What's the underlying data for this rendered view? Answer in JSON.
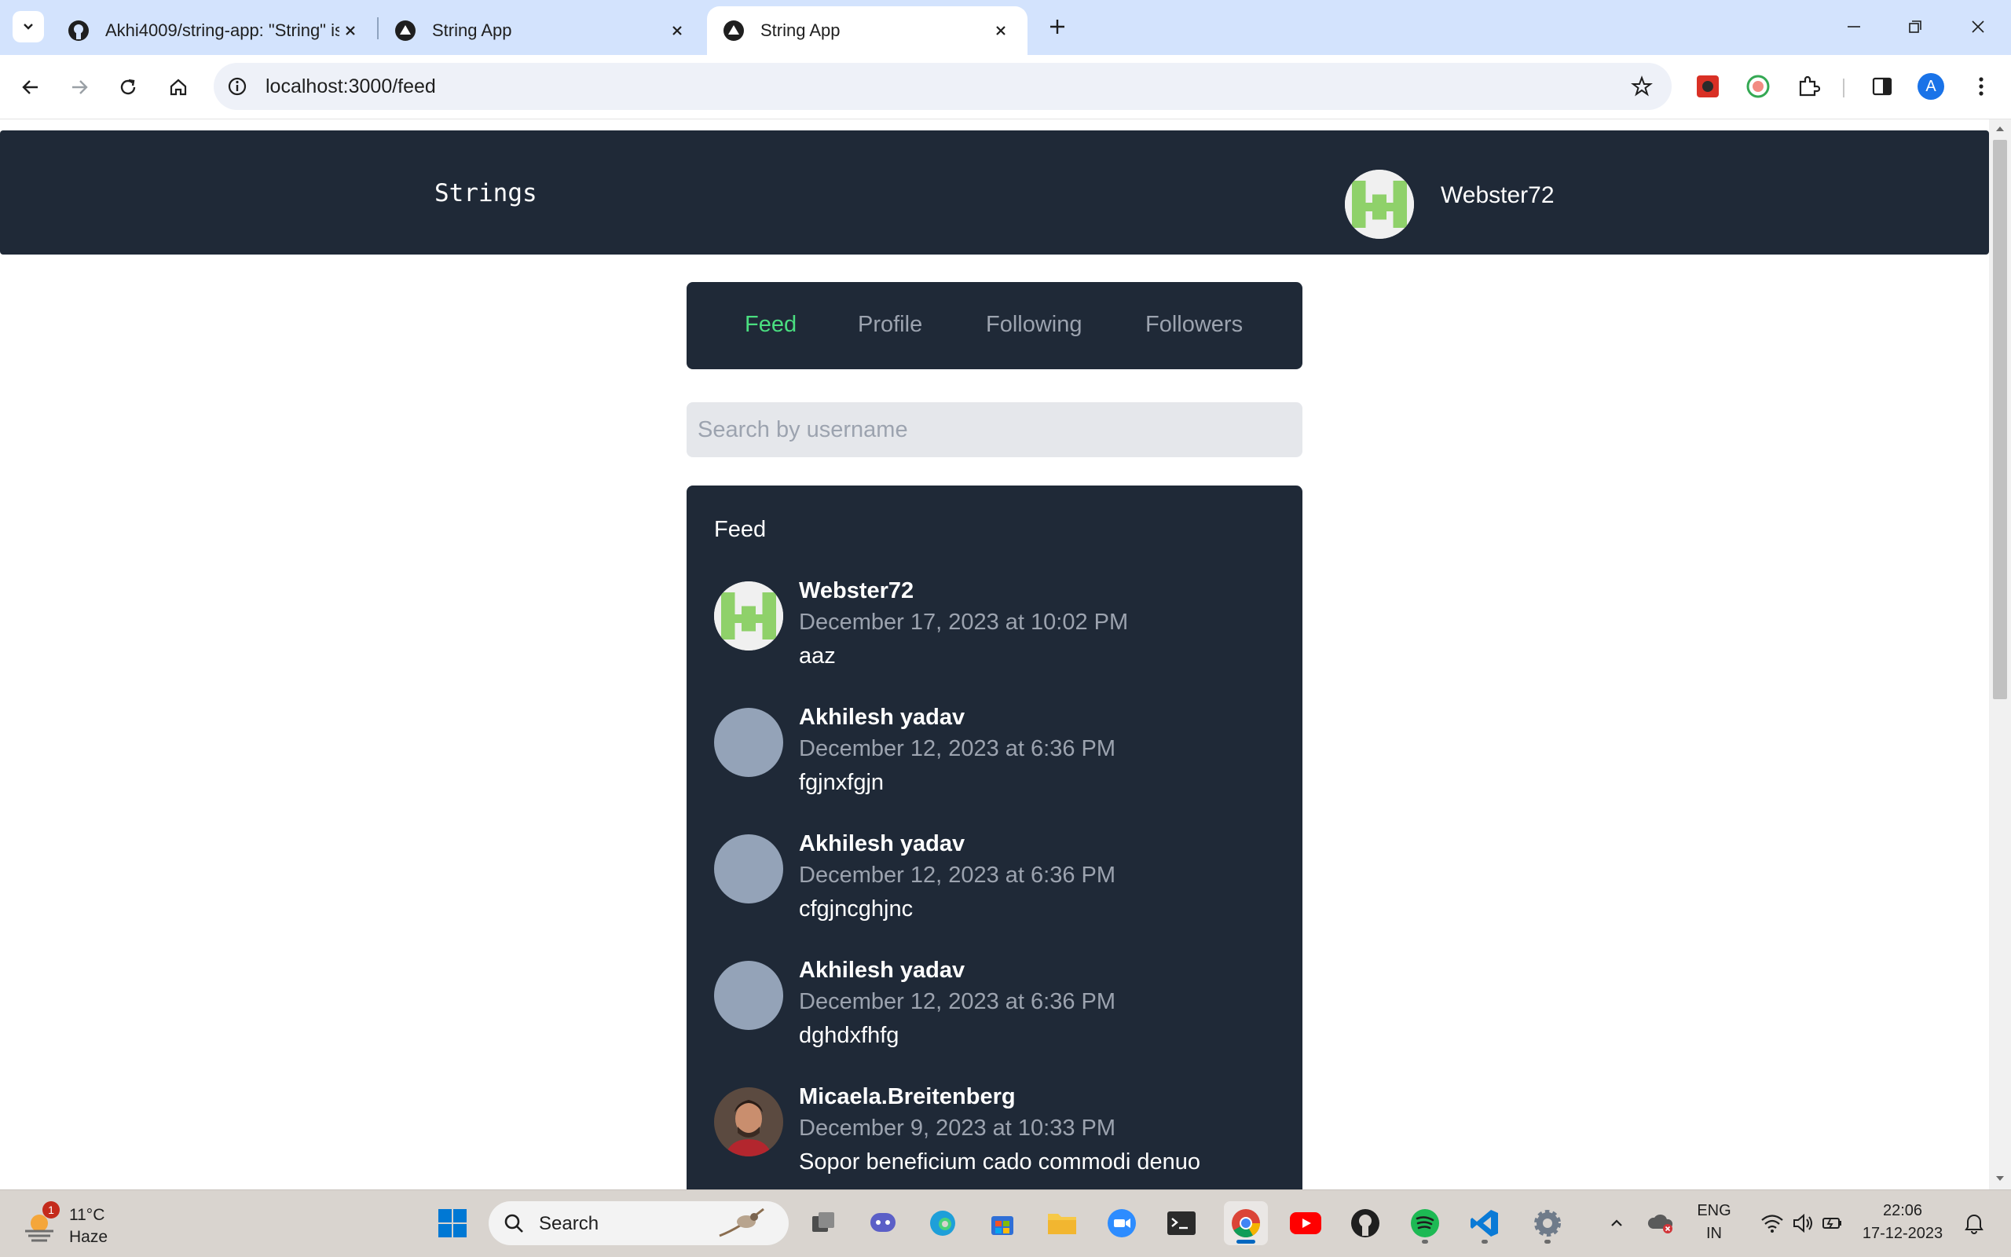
{
  "browser": {
    "tabs": [
      {
        "title": "Akhi4009/string-app: \"String\" is",
        "icon": "github-icon",
        "active": false
      },
      {
        "title": "String App",
        "icon": "vercel-icon",
        "active": false
      },
      {
        "title": "String App",
        "icon": "vercel-icon",
        "active": true
      }
    ],
    "url": "localhost:3000/feed",
    "profile_initial": "A"
  },
  "header": {
    "brand": "Strings",
    "username": "Webster72"
  },
  "nav": {
    "items": [
      "Feed",
      "Profile",
      "Following",
      "Followers"
    ],
    "active": "Feed"
  },
  "search": {
    "placeholder": "Search by username"
  },
  "feed": {
    "title": "Feed",
    "posts": [
      {
        "user": "Webster72",
        "date": "December 17, 2023 at 10:02 PM",
        "text": "aaz",
        "avatar": "identicon"
      },
      {
        "user": "Akhilesh yadav",
        "date": "December 12, 2023 at 6:36 PM",
        "text": "fgjnxfgjn",
        "avatar": "placeholder"
      },
      {
        "user": "Akhilesh yadav",
        "date": "December 12, 2023 at 6:36 PM",
        "text": "cfgjncghjnc",
        "avatar": "placeholder"
      },
      {
        "user": "Akhilesh yadav",
        "date": "December 12, 2023 at 6:36 PM",
        "text": "dghdxfhfg",
        "avatar": "placeholder"
      },
      {
        "user": "Micaela.Breitenberg",
        "date": "December 9, 2023 at 10:33 PM",
        "text": "Sopor beneficium cado commodi denuo",
        "avatar": "photo"
      }
    ]
  },
  "taskbar": {
    "weather_temp": "11°C",
    "weather_condition": "Haze",
    "weather_badge": "1",
    "search_label": "Search",
    "language_top": "ENG",
    "language_bottom": "IN",
    "time": "22:06",
    "date": "17-12-2023"
  },
  "colors": {
    "header_bg": "#1f2937",
    "accent": "#4ade80",
    "muted": "#9ca3af",
    "chrome_tabstrip": "#d3e3fd"
  }
}
